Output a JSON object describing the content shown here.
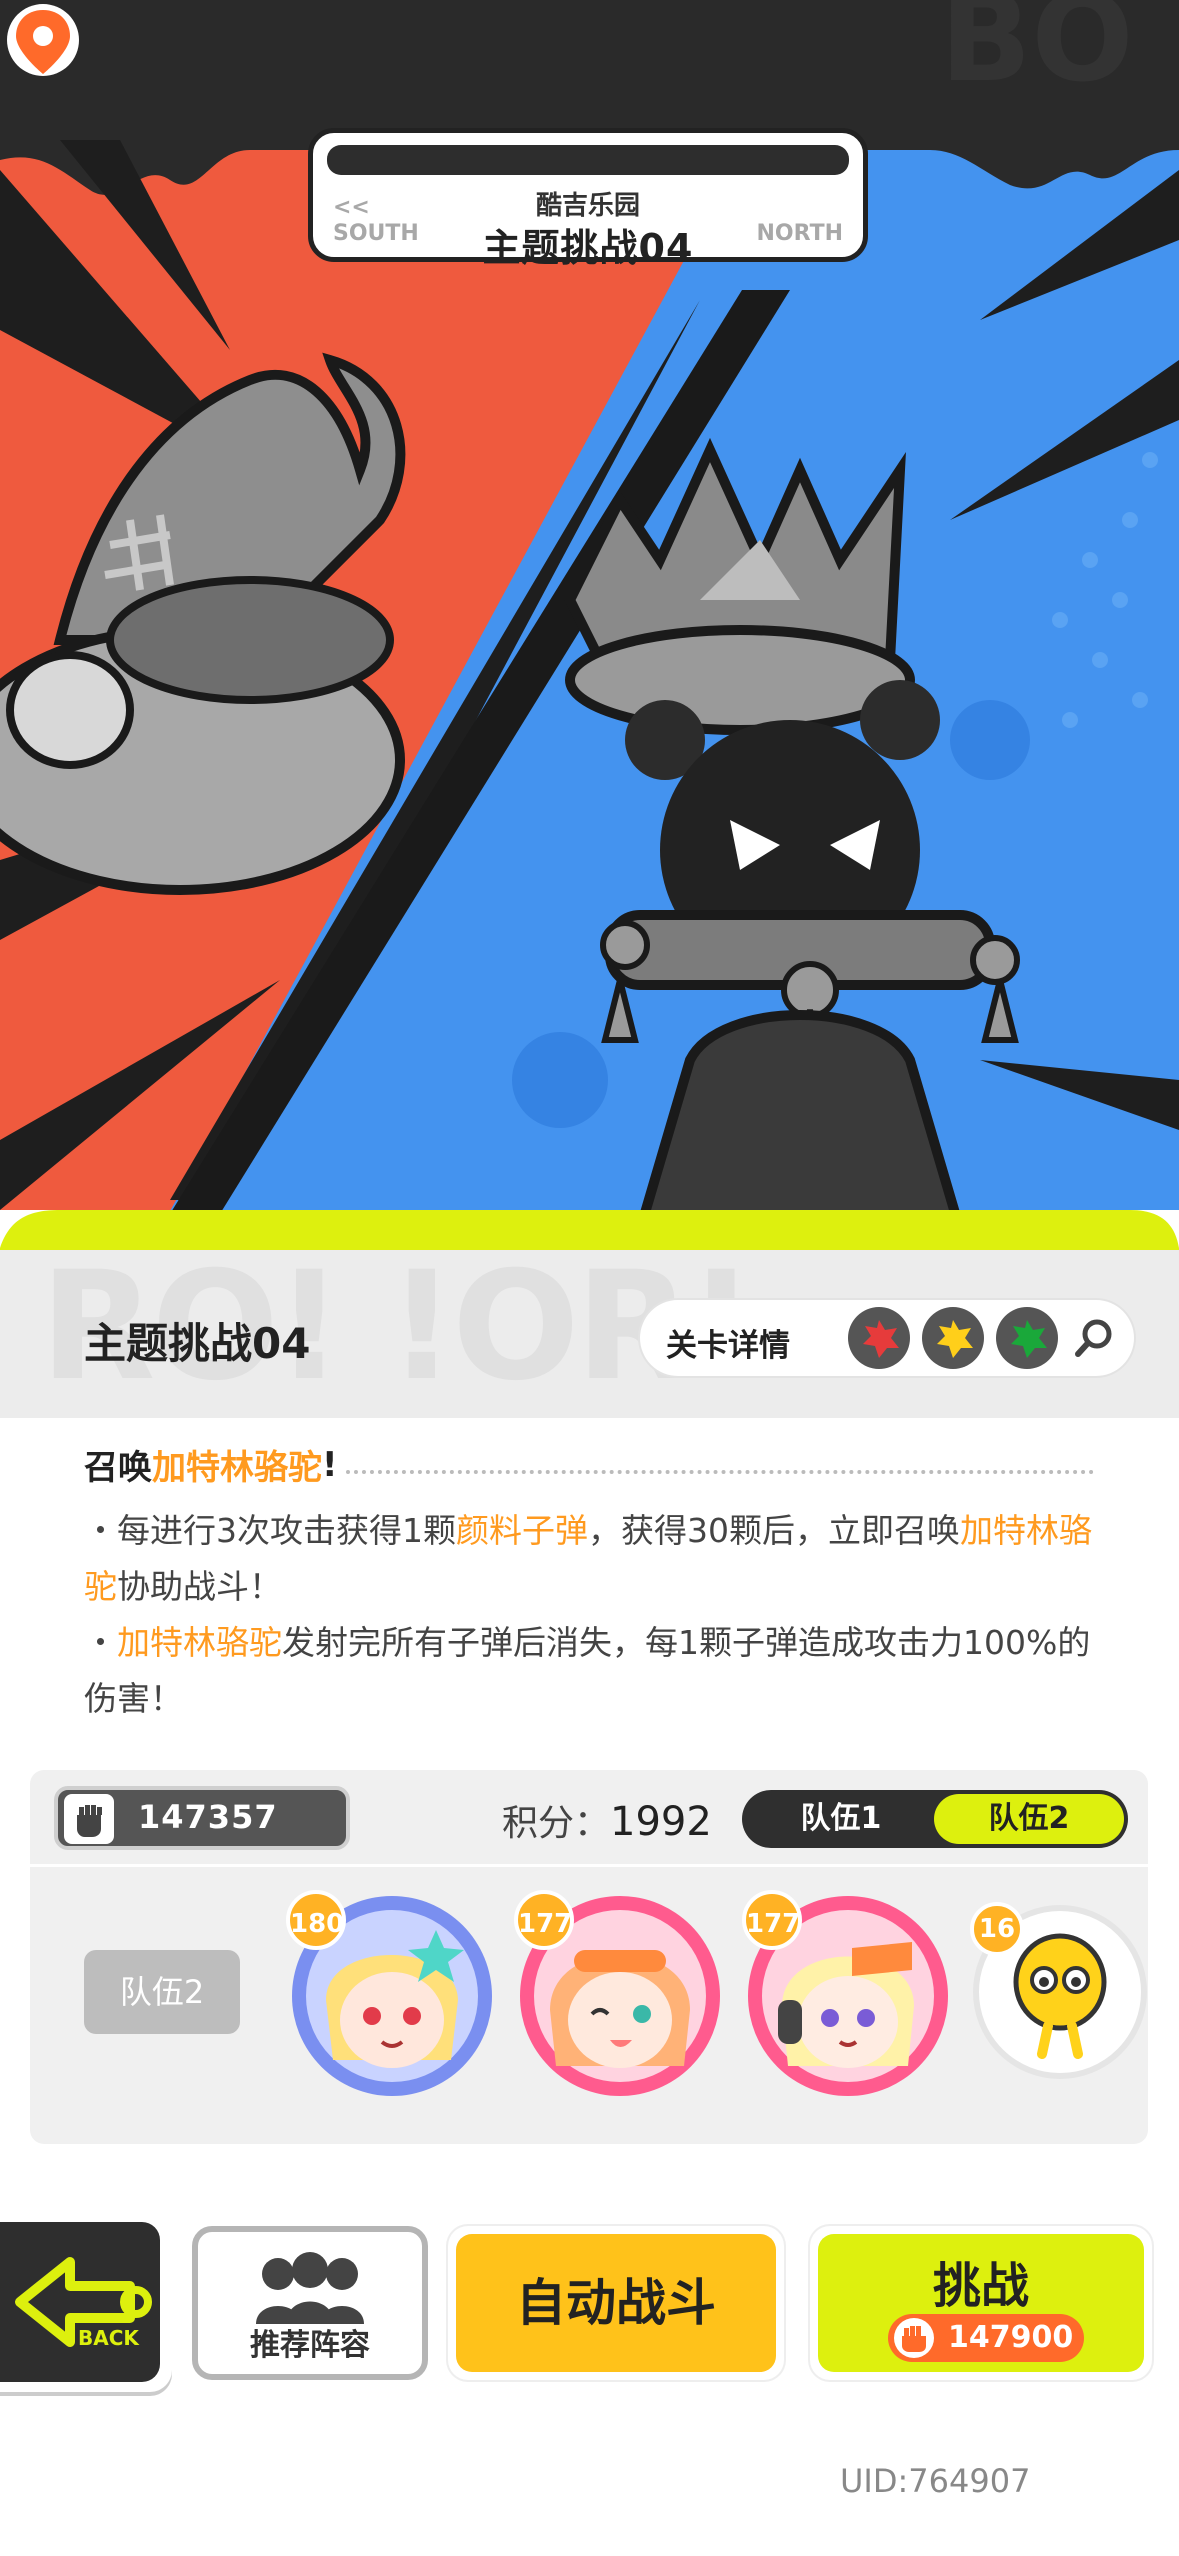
{
  "stage_header": {
    "park_name": "酷吉乐园",
    "stage_title": "主题挑战04",
    "south_label": "SOUTH",
    "north_label": "NORTH",
    "prev_arrow": "<<"
  },
  "level": {
    "title": "主题挑战04",
    "detail_label": "关卡详情",
    "gems": [
      "red-splat-icon",
      "yellow-splat-icon",
      "green-splat-icon"
    ]
  },
  "description": {
    "head_prefix": "召唤",
    "head_highlight": "加特林骆驼",
    "head_suffix": "!",
    "l1_a": "・每进行3次攻击获得1颗",
    "l1_hl": "颜料子弹",
    "l1_b": "，获得30颗后，立即召唤",
    "l1_hl2": "加特林骆驼",
    "l1_c": "协助战斗！",
    "l2_a": "・",
    "l2_hl": "加特林骆驼",
    "l2_b": "发射完所有子弹后消失，每1颗子弹造成攻击力100%的伤害！"
  },
  "team_panel": {
    "power": "147357",
    "score_label": "积分：",
    "score_value": "1992",
    "tab1": "队伍1",
    "tab2": "队伍2",
    "team_label": "队伍2",
    "members": [
      {
        "level": "180",
        "name": "blonde-hero-avatar"
      },
      {
        "level": "177",
        "name": "orange-hair-hero-avatar"
      },
      {
        "level": "177",
        "name": "headphone-hero-avatar"
      },
      {
        "level": "16",
        "name": "yellow-pet-avatar"
      }
    ]
  },
  "buttons": {
    "back": "BACK",
    "recommend": "推荐阵容",
    "auto_battle": "自动战斗",
    "challenge": "挑战",
    "challenge_cost": "147900"
  },
  "footer": {
    "uid": "UID:764907"
  },
  "colors": {
    "left_red": "#ef5a3e",
    "right_blue": "#4493ef",
    "accent_lime": "#ddf00e",
    "accent_orange": "#ff9a1f",
    "button_yellow": "#ffc21a"
  }
}
